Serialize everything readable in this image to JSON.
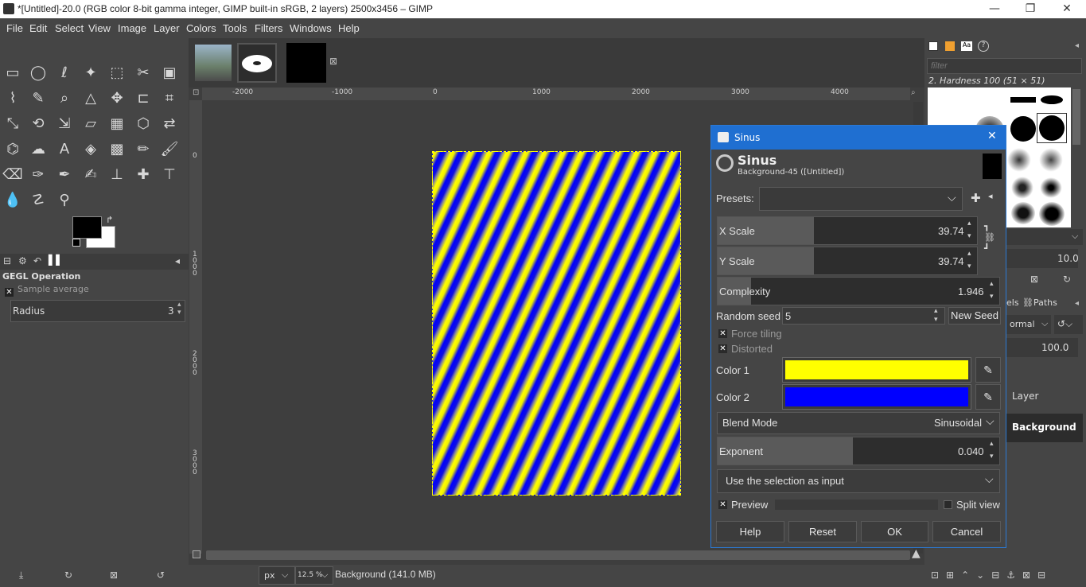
{
  "window": {
    "title": "*[Untitled]-20.0 (RGB color 8-bit gamma integer, GIMP built-in sRGB, 2 layers) 2500x3456 – GIMP",
    "minimize": "—",
    "restore": "❐",
    "close": "✕"
  },
  "menu": [
    "File",
    "Edit",
    "Select",
    "View",
    "Image",
    "Layer",
    "Colors",
    "Tools",
    "Filters",
    "Windows",
    "Help"
  ],
  "tool_options": {
    "title": "GEGL Operation",
    "sample_average_label": "Sample average",
    "radius_label": "Radius",
    "radius_value": "3"
  },
  "rulers": {
    "h_ticks": [
      "-2000",
      "-1000",
      "0",
      "1000",
      "2000",
      "3000",
      "4000"
    ],
    "v_ticks": [
      "0",
      "1\n0\n0\n0",
      "2\n0\n0\n0",
      "3\n0\n0\n0"
    ]
  },
  "statusbar": {
    "unit": "px",
    "zoom": "12.5 %",
    "layer_info": "Background (141.0 MB)"
  },
  "dialog": {
    "window_title": "Sinus",
    "header_title": "Sinus",
    "header_subtitle": "Background-45 ([Untitled])",
    "presets_label": "Presets:",
    "x_scale_label": "X Scale",
    "x_scale_value": "39.74",
    "x_scale_fraction": 0.34,
    "y_scale_label": "Y Scale",
    "y_scale_value": "39.74",
    "y_scale_fraction": 0.34,
    "complexity_label": "Complexity",
    "complexity_value": "1.946",
    "complexity_fraction": 0.12,
    "random_seed_label": "Random seed",
    "random_seed_value": "5",
    "new_seed_label": "New Seed",
    "force_tiling_label": "Force tiling",
    "distorted_label": "Distorted",
    "color1_label": "Color 1",
    "color1": "#ffff00",
    "color2_label": "Color 2",
    "color2": "#0000ff",
    "blend_mode_label": "Blend Mode",
    "blend_mode_value": "Sinusoidal",
    "exponent_label": "Exponent",
    "exponent_value": "0.040",
    "exponent_fraction": 0.48,
    "selection_input": "Use the selection as input",
    "preview_label": "Preview",
    "split_view_label": "Split view",
    "buttons": {
      "help": "Help",
      "reset": "Reset",
      "ok": "OK",
      "cancel": "Cancel"
    }
  },
  "right_dock": {
    "filter_placeholder": "filter",
    "brush_name": "2. Hardness 100 (51 × 51)",
    "spacing_value": "10.0",
    "tabs_paths": "Paths",
    "tabs_partial": "els",
    "mode_partial": "ormal",
    "opacity_value": "100.0",
    "layers": [
      "Layer",
      "Background"
    ]
  }
}
